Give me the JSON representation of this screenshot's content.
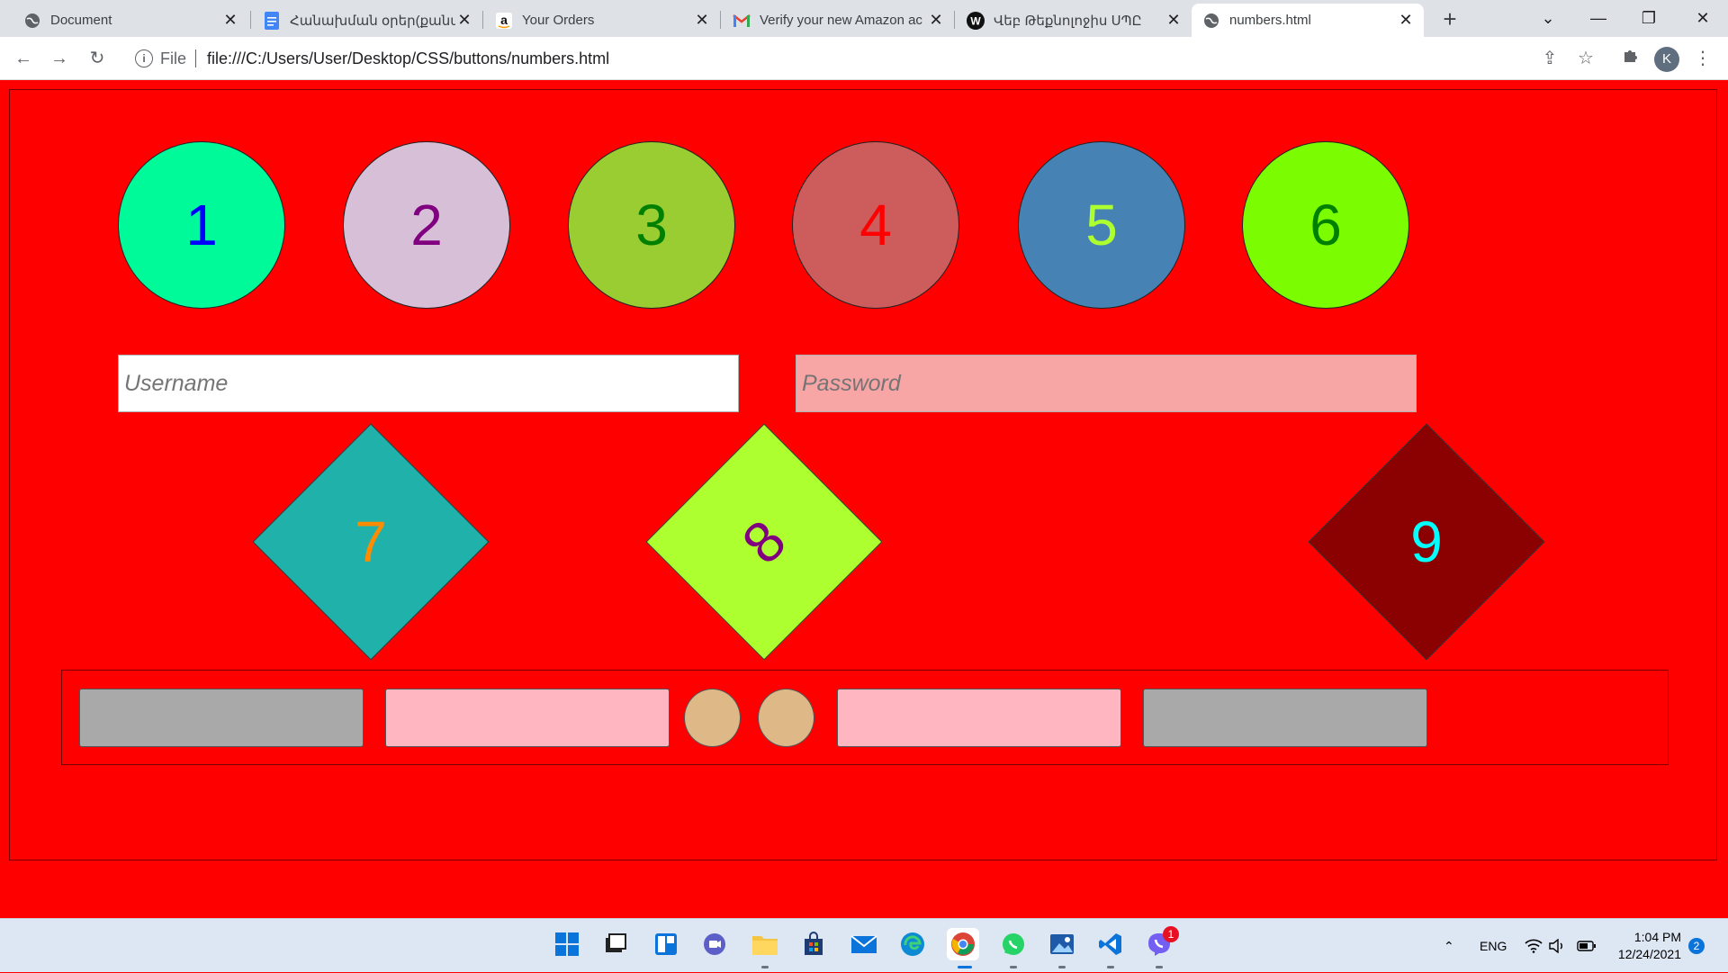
{
  "browser": {
    "tabs": [
      {
        "title": "Document",
        "favicon": "globe-icon",
        "active": false
      },
      {
        "title": "Հանախման օրեր(քանակ",
        "favicon": "docs-icon",
        "active": false
      },
      {
        "title": "Your Orders",
        "favicon": "amazon-icon",
        "active": false
      },
      {
        "title": "Verify your new Amazon ac",
        "favicon": "gmail-icon",
        "active": false
      },
      {
        "title": "Վեբ Թեքնոլոջիս ՍՊԸ",
        "favicon": "w-logo-icon",
        "active": false
      },
      {
        "title": "numbers.html",
        "favicon": "globe-icon",
        "active": true
      }
    ],
    "address": {
      "scheme_label": "File",
      "url": "file:///C:/Users/User/Desktop/CSS/buttons/numbers.html"
    },
    "profile_initial": "K"
  },
  "page": {
    "circles": [
      {
        "label": "1",
        "bg": "#00fa9a",
        "fg": "#0000ff"
      },
      {
        "label": "2",
        "bg": "#d8bfd8",
        "fg": "#800080"
      },
      {
        "label": "3",
        "bg": "#9acd32",
        "fg": "#008000"
      },
      {
        "label": "4",
        "bg": "#cd5c5c",
        "fg": "#ff0000"
      },
      {
        "label": "5",
        "bg": "#4682b4",
        "fg": "#adff2f"
      },
      {
        "label": "6",
        "bg": "#7cfc00",
        "fg": "#008000"
      }
    ],
    "username": {
      "placeholder": "Username",
      "value": "",
      "bg": "#ffffff"
    },
    "password": {
      "placeholder": "Password",
      "value": "",
      "bg": "#f8a5a5"
    },
    "diamonds": [
      {
        "label": "7",
        "bg": "#20b2aa",
        "fg": "#ff8c00"
      },
      {
        "label": "8",
        "bg": "#adff2f",
        "fg": "#800080"
      },
      {
        "label": "9",
        "bg": "#8b0000",
        "fg": "#00ffff"
      }
    ],
    "buttons": [
      {
        "shape": "rect",
        "bg": "#a9a9a9"
      },
      {
        "shape": "rect",
        "bg": "#ffb6c1"
      },
      {
        "shape": "round",
        "bg": "#deb887"
      },
      {
        "shape": "round",
        "bg": "#deb887"
      },
      {
        "shape": "rect",
        "bg": "#ffb6c1"
      },
      {
        "shape": "rect",
        "bg": "#a9a9a9"
      }
    ]
  },
  "taskbar": {
    "apps": [
      "start-icon",
      "task-view-icon",
      "widgets-icon",
      "chat-icon",
      "file-explorer-icon",
      "store-icon",
      "mail-icon",
      "edge-icon",
      "chrome-icon",
      "whatsapp-icon",
      "photos-icon",
      "vscode-icon",
      "viber-icon"
    ],
    "viber_badge": "1",
    "language": "ENG",
    "time": "1:04 PM",
    "date": "12/24/2021",
    "notifications": "2"
  }
}
